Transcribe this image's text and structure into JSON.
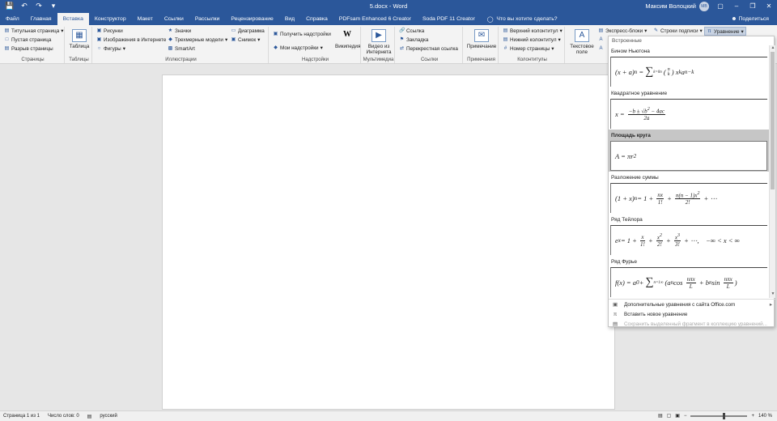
{
  "titlebar": {
    "title": "5.docx  -  Word",
    "user": "Максим Волоцкий",
    "avatar_initials": "МВ"
  },
  "tabs": [
    "Файл",
    "Главная",
    "Вставка",
    "Конструктор",
    "Макет",
    "Ссылки",
    "Рассылки",
    "Рецензирование",
    "Вид",
    "Справка",
    "PDFsam Enhanced 6 Creator",
    "Soda PDF 11 Creator"
  ],
  "tellme": "Что вы хотите сделать?",
  "share": "Поделиться",
  "ribbon": {
    "pages": {
      "items": [
        "Титульная страница",
        "Пустая страница",
        "Разрыв страницы"
      ],
      "label": "Страницы"
    },
    "tables": {
      "button": "Таблица",
      "label": "Таблицы"
    },
    "illustrations": {
      "col1": [
        "Рисунки",
        "Изображения в Интернете",
        "Фигуры"
      ],
      "col2": [
        "Значки",
        "Трехмерные модели",
        "SmartArt"
      ],
      "col3": [
        "Диаграмма",
        "Снимок"
      ],
      "label": "Иллюстрации"
    },
    "addins": {
      "items": [
        "Получить надстройки",
        "Мои надстройки"
      ],
      "wiki": "Википедия",
      "label": "Надстройки"
    },
    "media": {
      "button": "Видео из Интернета",
      "label": "Мультимедиа"
    },
    "links": {
      "items": [
        "Ссылка",
        "Закладка",
        "Перекрестная ссылка"
      ],
      "label": "Ссылки"
    },
    "comments": {
      "button": "Примечание",
      "label": "Примечания"
    },
    "headerfooter": {
      "items": [
        "Верхний колонтитул",
        "Нижний колонтитул",
        "Номер страницы"
      ],
      "label": "Колонтитулы"
    },
    "text": {
      "textbox": "Текстовое поле",
      "quickparts": "Экспресс-блоки",
      "signature": "Строки подписи"
    },
    "symbols": {
      "equation": "Уравнение"
    }
  },
  "equation_gallery": {
    "header": "Встроенные",
    "items": [
      {
        "title": "Бином Ньютона",
        "selected": false
      },
      {
        "title": "Квадратное уравнение",
        "selected": false
      },
      {
        "title": "Площадь круга",
        "selected": true
      },
      {
        "title": "Разложение суммы",
        "selected": false
      },
      {
        "title": "Ряд Тейлора",
        "selected": false
      },
      {
        "title": "Ряд Фурье",
        "selected": false
      }
    ],
    "actions": [
      {
        "label": "Дополнительные уравнения с сайта Office.com",
        "enabled": true,
        "submenu": true
      },
      {
        "label": "Вставить новое уравнение",
        "enabled": true,
        "submenu": false
      },
      {
        "label": "Сохранить выделенный фрагмент в коллекцию уравнений...",
        "enabled": false,
        "submenu": false
      }
    ]
  },
  "status": {
    "page": "Страница 1 из 1",
    "words": "Число слов: 0",
    "language": "русский",
    "zoom": "140 %"
  }
}
